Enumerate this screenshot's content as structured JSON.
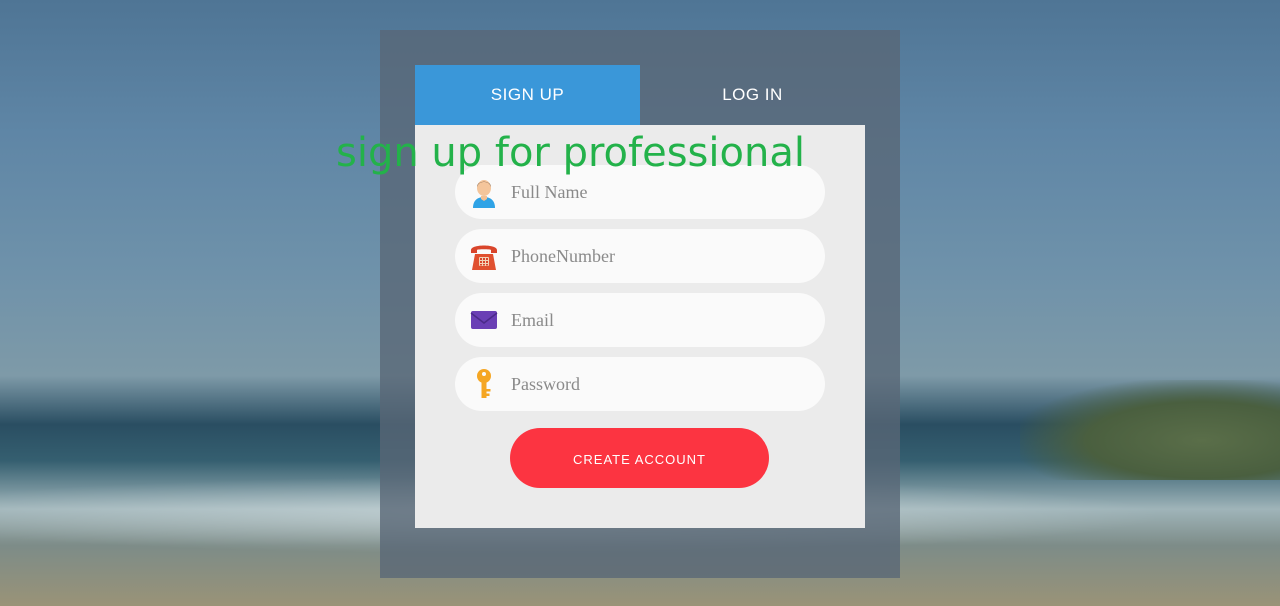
{
  "tabs": {
    "signup_label": "SIGN UP",
    "login_label": "LOG IN"
  },
  "overlay_title": "sign up for professional",
  "form": {
    "full_name": {
      "placeholder": "Full Name",
      "icon": "person-icon"
    },
    "phone": {
      "placeholder": "PhoneNumber",
      "icon": "telephone-icon"
    },
    "email": {
      "placeholder": "Email",
      "icon": "envelope-icon"
    },
    "password": {
      "placeholder": "Password",
      "icon": "key-icon"
    },
    "submit_label": "CREATE ACCOUNT"
  },
  "colors": {
    "tab_active": "#3a97d9",
    "button": "#fc3441",
    "title": "#23b24a"
  }
}
